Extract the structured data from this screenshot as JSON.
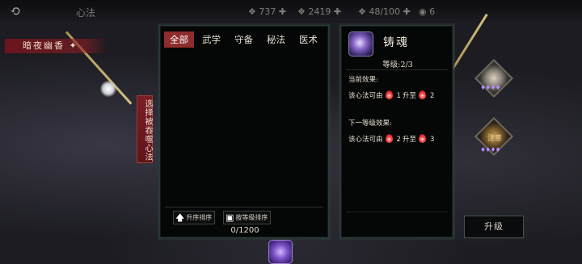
{
  "hud": {
    "back_label": "⟲",
    "title": "心法",
    "resources": [
      "❖ 737 ✚",
      "❖ 2419 ✚",
      "❖ 48/100 ✚",
      "◉ 6"
    ]
  },
  "map": {
    "banner": "暗夜幽香 ✦",
    "select_tag": "选择被吞噬心法",
    "figure_label": "注意"
  },
  "left_panel": {
    "tabs": [
      {
        "label": "全部",
        "active": true
      },
      {
        "label": "武学",
        "active": false
      },
      {
        "label": "守备",
        "active": false
      },
      {
        "label": "秘法",
        "active": false
      },
      {
        "label": "医术",
        "active": false
      }
    ],
    "sort_asc_label": "升序排序",
    "sort_level_label": "按等级排序",
    "count": "0/1200"
  },
  "right_panel": {
    "skill_name": "铸魂",
    "level_text": "等级:2/3",
    "current_label": "当前效果:",
    "current_effect": {
      "prefix": "该心法可由",
      "from": "1",
      "mid": "升至",
      "to": "2"
    },
    "next_label": "下一等级效果:",
    "next_effect": {
      "prefix": "该心法可由",
      "from": "2",
      "mid": "升至",
      "to": "3"
    }
  },
  "upgrade_label": "升级",
  "colors": {
    "accent": "#8e2b2b",
    "panel_border": "#2c3a38",
    "gem": "#ff4b4b"
  }
}
